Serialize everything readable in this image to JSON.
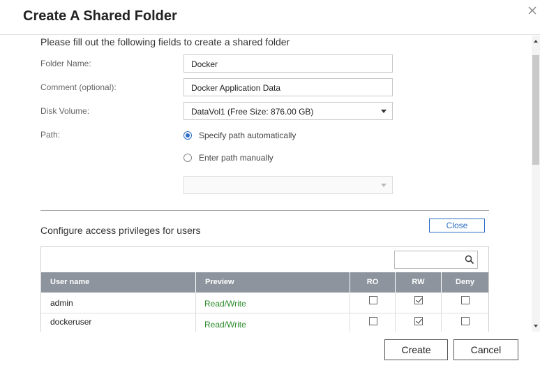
{
  "dialog": {
    "title": "Create A Shared Folder",
    "close_icon": "close-icon"
  },
  "form": {
    "heading": "Please fill out the following fields to create a shared folder",
    "folder_name_label": "Folder Name:",
    "folder_name_value": "Docker",
    "comment_label": "Comment (optional):",
    "comment_value": "Docker Application Data",
    "disk_volume_label": "Disk Volume:",
    "disk_volume_value": "DataVol1 (Free Size: 876.00 GB)",
    "path_label": "Path:",
    "path_auto_label": "Specify path automatically",
    "path_auto_selected": true,
    "path_manual_label": "Enter path manually",
    "path_manual_selected": false,
    "path_manual_value": ""
  },
  "privileges": {
    "heading": "Configure access privileges for users",
    "close_label": "Close",
    "search_placeholder": "",
    "columns": [
      "User name",
      "Preview",
      "RO",
      "RW",
      "Deny"
    ],
    "rows": [
      {
        "user": "admin",
        "preview": "Read/Write",
        "ro": false,
        "rw": true,
        "deny": false
      },
      {
        "user": "dockeruser",
        "preview": "Read/Write",
        "ro": false,
        "rw": true,
        "deny": false
      }
    ]
  },
  "footer": {
    "create_label": "Create",
    "cancel_label": "Cancel"
  },
  "colors": {
    "accent": "#2b6cc4",
    "preview_green": "#2a8a2a",
    "table_header": "#8d949e"
  }
}
